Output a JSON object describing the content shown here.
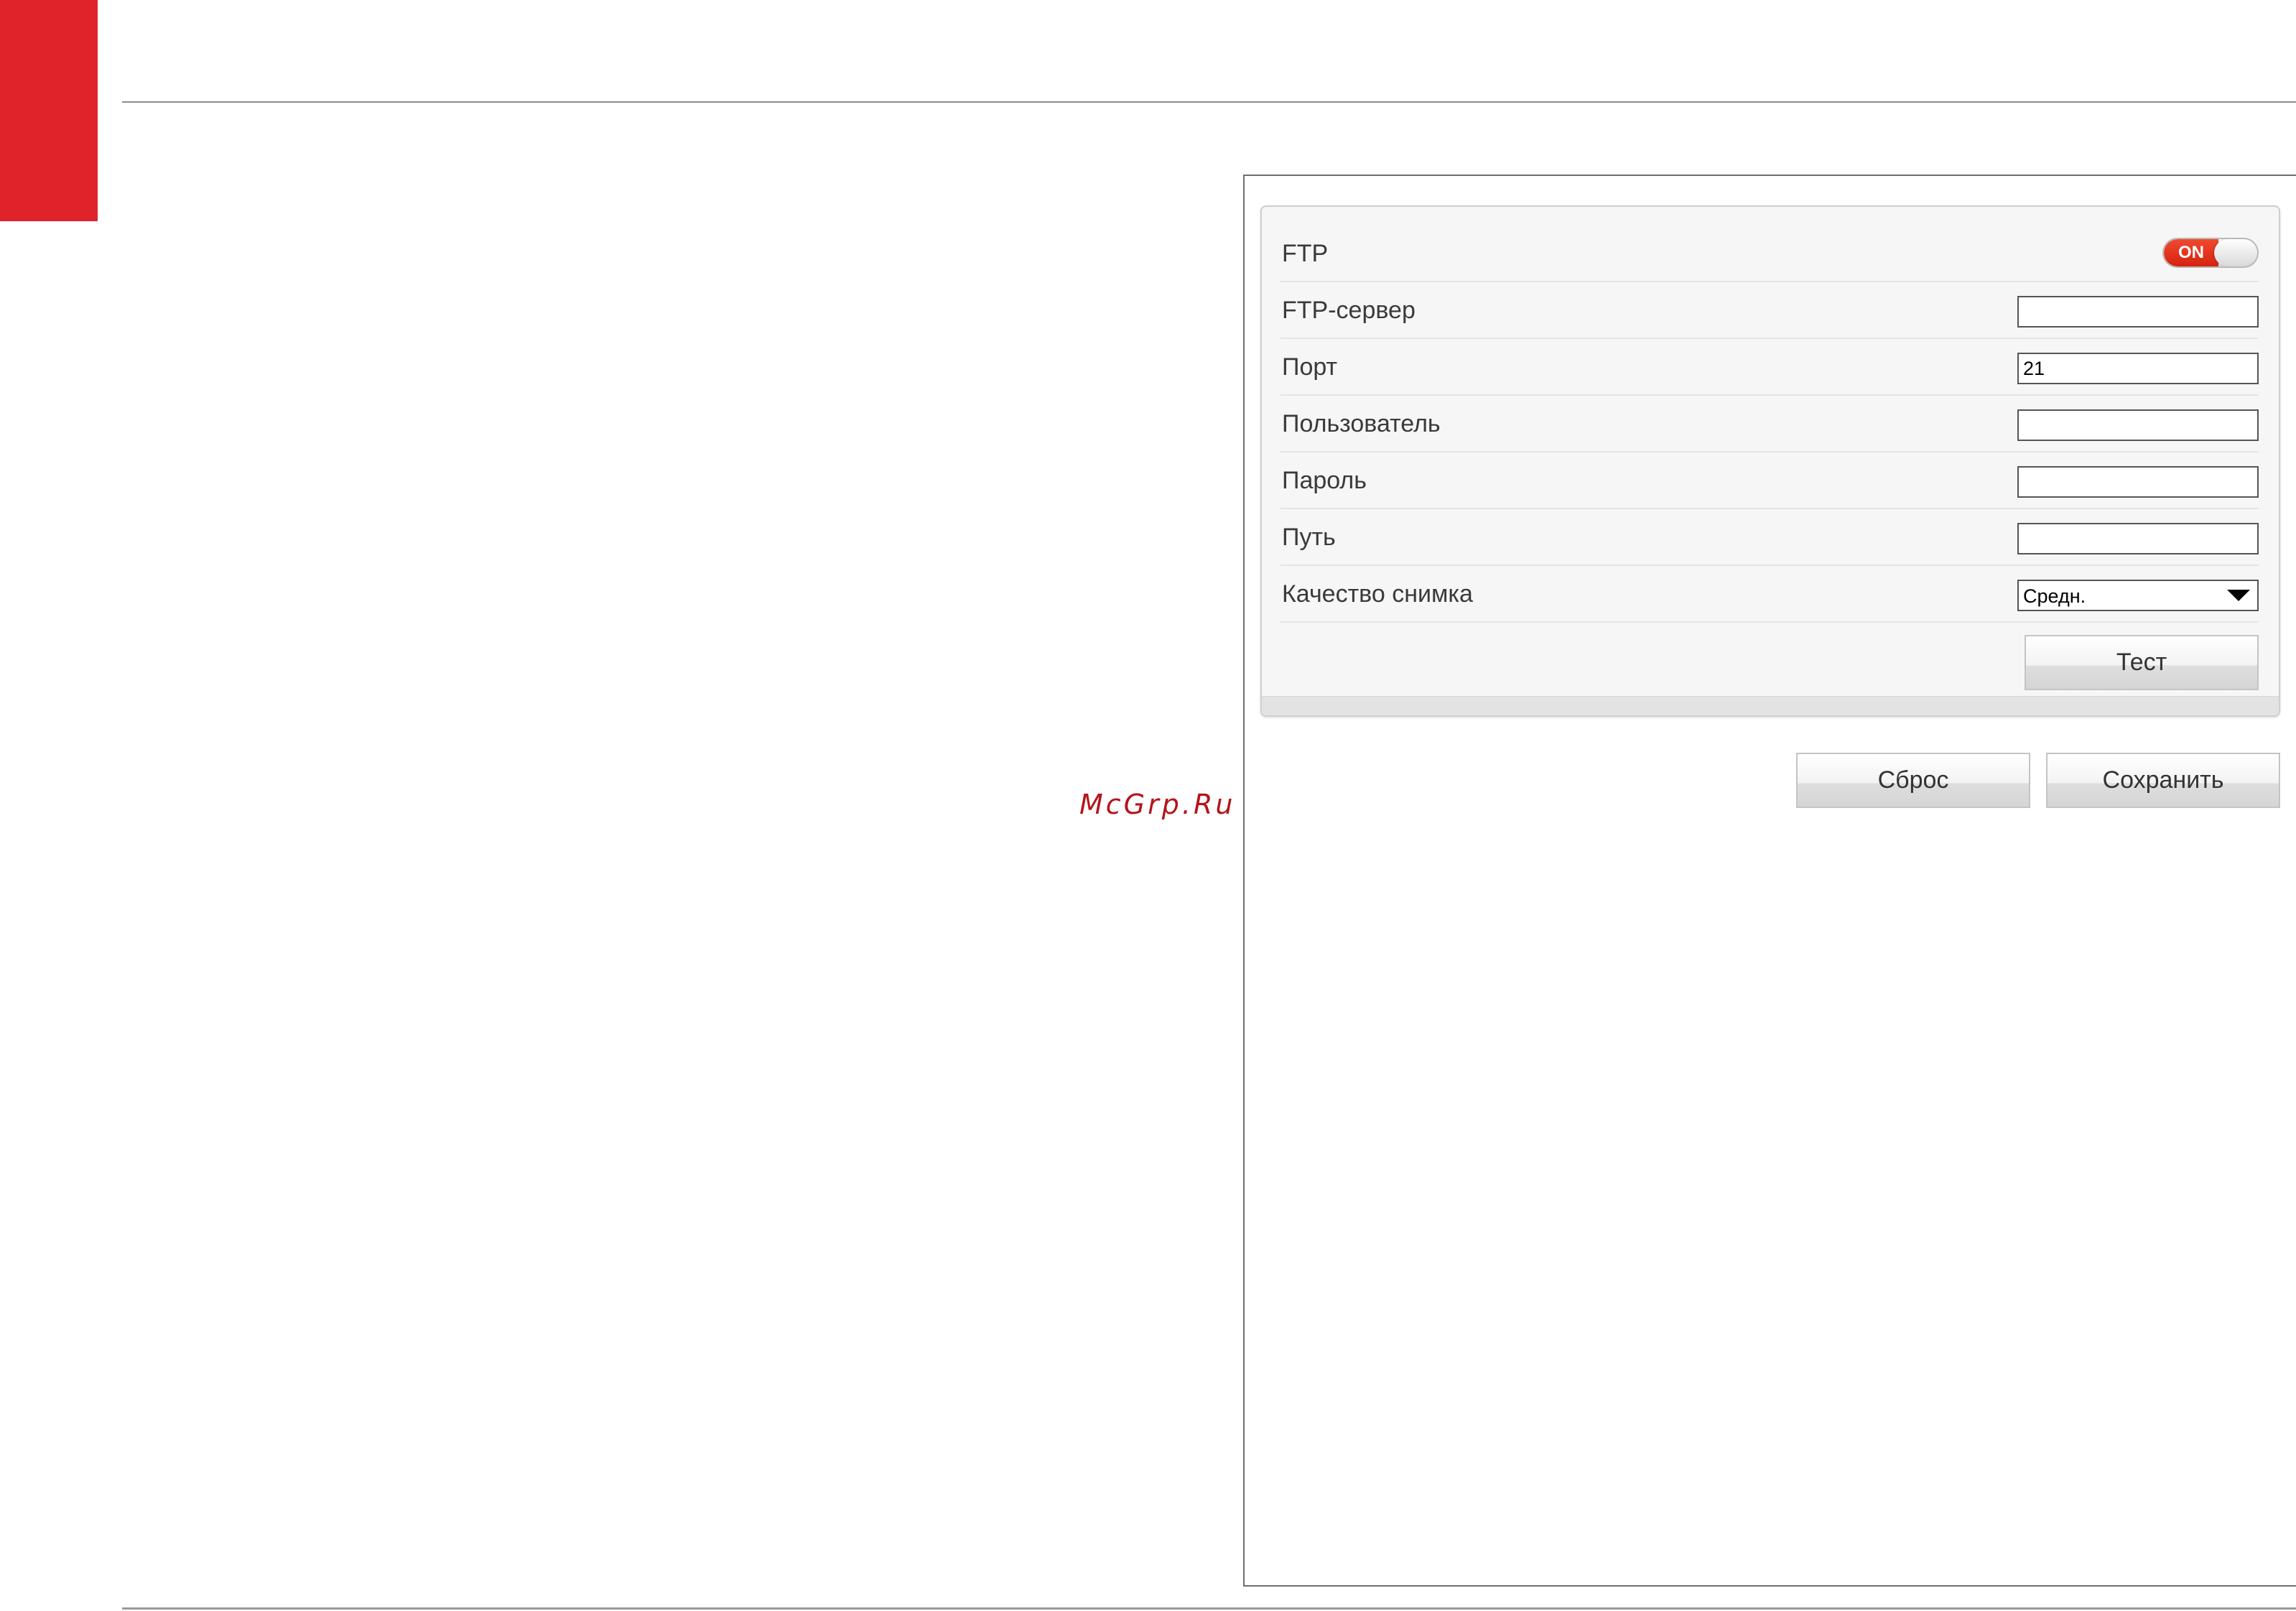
{
  "watermark": "McGrp.Ru",
  "ftp_form": {
    "rows": [
      {
        "label": "FTP",
        "control": "toggle",
        "toggle_text": "ON",
        "toggle_state": "on"
      },
      {
        "label": "FTP-сервер",
        "control": "input",
        "value": ""
      },
      {
        "label": "Порт",
        "control": "input",
        "value": "21"
      },
      {
        "label": "Пользователь",
        "control": "input",
        "value": ""
      },
      {
        "label": "Пароль",
        "control": "input",
        "value": ""
      },
      {
        "label": "Путь",
        "control": "input",
        "value": ""
      },
      {
        "label": "Качество снимка",
        "control": "select",
        "value": "Средн."
      }
    ],
    "test_button": "Тест"
  },
  "actions": {
    "reset_label": "Сброс",
    "save_label": "Сохранить"
  },
  "colors": {
    "accent_red": "#e0222b",
    "toggle_on": "#e5361c",
    "watermark": "#b5141b"
  }
}
